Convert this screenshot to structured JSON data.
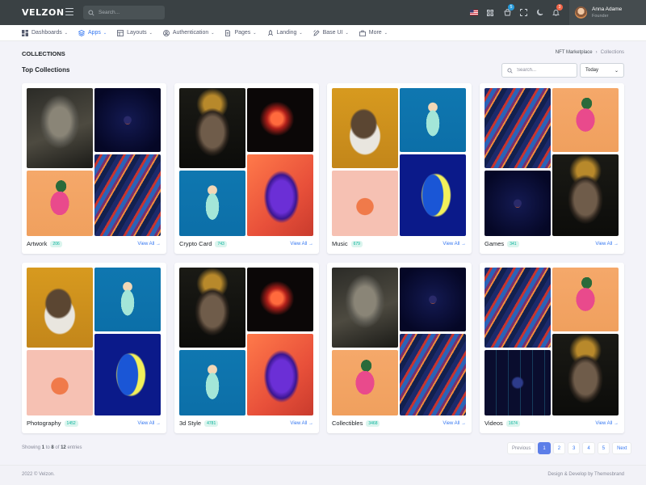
{
  "brand": {
    "logo": "VELZON"
  },
  "header": {
    "search_placeholder": "Search...",
    "cart_count": "5",
    "notif_count": "3",
    "user_name": "Anna Adame",
    "user_role": "Founder"
  },
  "nav": {
    "items": [
      {
        "label": "Dashboards",
        "icon": "dashboard-icon"
      },
      {
        "label": "Apps",
        "icon": "apps-icon",
        "active": true
      },
      {
        "label": "Layouts",
        "icon": "layouts-icon"
      },
      {
        "label": "Authentication",
        "icon": "account-circle-icon"
      },
      {
        "label": "Pages",
        "icon": "pages-icon"
      },
      {
        "label": "Landing",
        "icon": "rocket-icon"
      },
      {
        "label": "Base UI",
        "icon": "pencil-ruler-icon"
      },
      {
        "label": "More",
        "icon": "briefcase-icon"
      }
    ]
  },
  "page": {
    "title": "COLLECTIONS",
    "breadcrumb": [
      "NFT Marketplace",
      "Collections"
    ],
    "section_title": "Top Collections",
    "search_placeholder": "Search...",
    "filter_value": "Today"
  },
  "collections": [
    {
      "name": "Artwork",
      "count": "206",
      "view_all": "View All →"
    },
    {
      "name": "Crypto Card",
      "count": "743",
      "view_all": "View All →"
    },
    {
      "name": "Music",
      "count": "679",
      "view_all": "View All →"
    },
    {
      "name": "Games",
      "count": "341",
      "view_all": "View All →"
    },
    {
      "name": "Photography",
      "count": "1452",
      "view_all": "View All →"
    },
    {
      "name": "3d Style",
      "count": "4781",
      "view_all": "View All →"
    },
    {
      "name": "Collectibles",
      "count": "3468",
      "view_all": "View All →"
    },
    {
      "name": "Videos",
      "count": "1674",
      "view_all": "View All →"
    }
  ],
  "pagination": {
    "showing_prefix": "Showing",
    "from": "1",
    "to_word": "to",
    "to": "8",
    "of_word": "of",
    "total": "12",
    "suffix": "entries",
    "prev": "Previous",
    "pages": [
      "1",
      "2",
      "3",
      "4",
      "5"
    ],
    "current": "1",
    "next": "Next"
  },
  "footer": {
    "left": "2022 © Velzon.",
    "right": "Design & Develop by Themesbrand"
  },
  "colors": {
    "primary": "#3577f1",
    "success": "#0ab39c",
    "danger": "#f06548",
    "info": "#299cdb",
    "header_bg": "#3a4144"
  }
}
